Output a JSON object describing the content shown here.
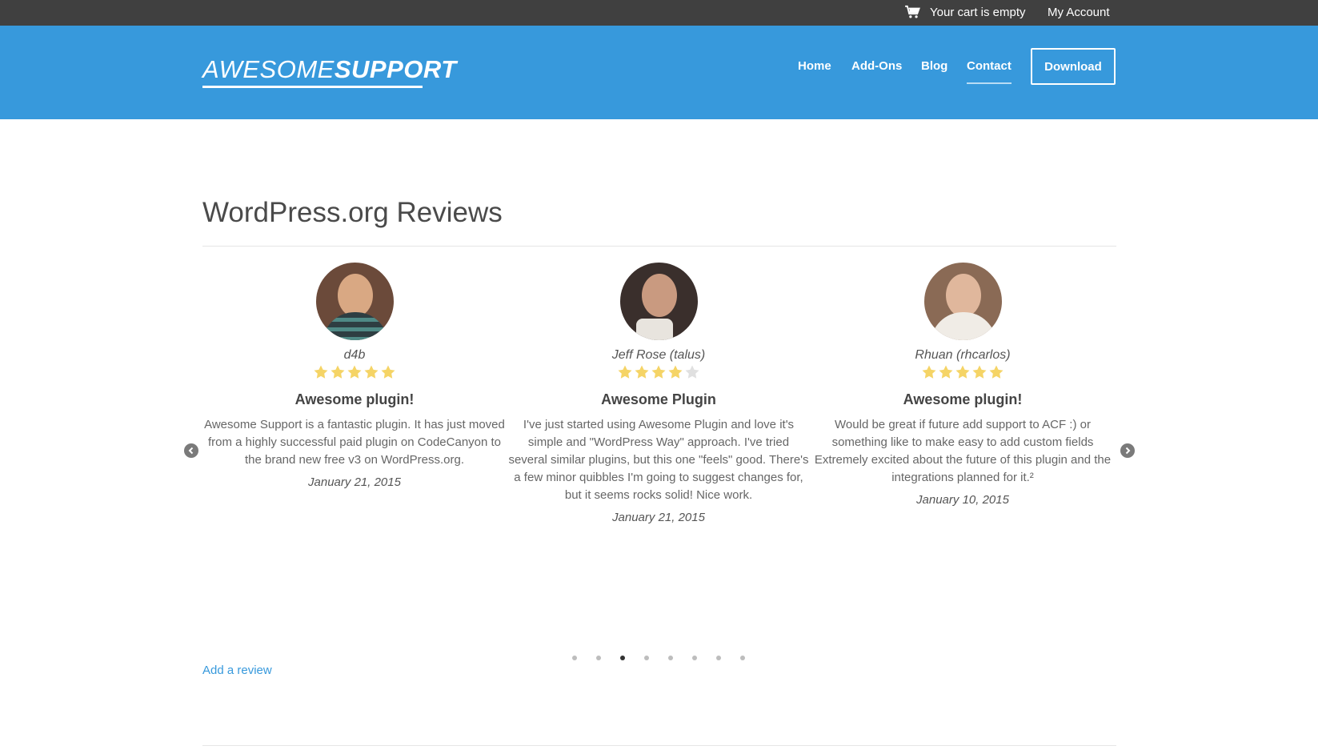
{
  "topbar": {
    "cart_icon": "shopping-cart-icon",
    "cart_text": "Your cart is empty",
    "account_link": "My Account"
  },
  "header": {
    "logo_light": "AWESOME",
    "logo_bold": "SUPPORT",
    "nav": [
      "Home",
      "Add-Ons",
      "Blog",
      "Contact"
    ],
    "active_nav": "Contact",
    "download_label": "Download",
    "bg_color": "#3799dc"
  },
  "section": {
    "title": "WordPress.org Reviews"
  },
  "reviews": [
    {
      "reviewer": "d4b",
      "rating": 5,
      "title": "Awesome plugin!",
      "text": "Awesome Support is a fantastic plugin. It has just moved from a highly successful paid plugin on CodeCanyon to the brand new free v3 on WordPress.org.",
      "date": "January 21, 2015"
    },
    {
      "reviewer": "Jeff Rose (talus)",
      "rating": 4,
      "title": "Awesome Plugin",
      "text": "I've just started using Awesome Plugin and love it's simple and \"WordPress Way\" approach. I've tried several similar plugins, but this one \"feels\" good. There's a few minor quibbles I'm going to suggest changes for, but it seems rocks solid! Nice work.",
      "date": "January 21, 2015"
    },
    {
      "reviewer": "Rhuan (rhcarlos)",
      "rating": 5,
      "title": "Awesome plugin!",
      "text": "Would be great if future add support to ACF :) or something like to make easy to add custom fields Extremely excited about the future of this plugin and the integrations planned for it.²",
      "date": "January 10, 2015"
    }
  ],
  "carousel": {
    "prev_icon": "chevron-left-icon",
    "next_icon": "chevron-right-icon",
    "dot_count": 8,
    "active_dot": 3
  },
  "add_review_label": "Add a review",
  "star_color": "#f5d466",
  "star_empty_color": "#e0e0e0"
}
